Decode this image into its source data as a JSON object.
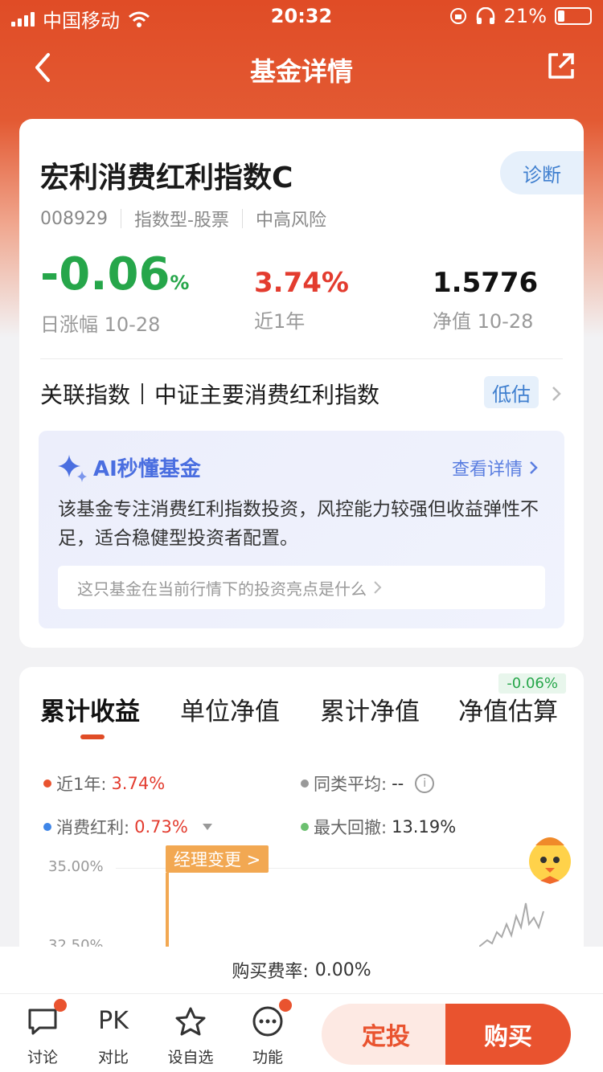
{
  "status_bar": {
    "carrier": "中国移动",
    "time": "20:32",
    "battery": "21%"
  },
  "nav": {
    "title": "基金详情"
  },
  "fund": {
    "name": "宏利消费红利指数C",
    "diagnose_label": "诊断",
    "code": "008929",
    "type": "指数型-股票",
    "risk": "中高风险",
    "daily_change": "-0.06",
    "daily_change_unit": "%",
    "daily_change_label": "日涨幅 10-28",
    "year_return": "3.74%",
    "year_return_label": "近1年",
    "nav_value": "1.5776",
    "nav_label": "净值 10-28",
    "index_prefix": "关联指数",
    "index_name": "中证主要消费红利指数",
    "valuation": "低估"
  },
  "ai": {
    "title": "AI秒懂基金",
    "more": "查看详情",
    "summary": "该基金专注消费红利指数投资，风控能力较强但收益弹性不足，适合稳健型投资者配置。",
    "question": "这只基金在当前行情下的投资亮点是什么"
  },
  "performance": {
    "tabs": [
      "累计收益",
      "单位净值",
      "累计净值",
      "净值估算"
    ],
    "estimate_badge": "-0.06%",
    "legend": {
      "year_label": "近1年:",
      "year_value": "3.74%",
      "peer_label": "同类平均:",
      "peer_value": "--",
      "index_label": "消费红利:",
      "index_value": "0.73%",
      "drawdown_label": "最大回撤:",
      "drawdown_value": "13.19%"
    },
    "colors": {
      "fund": "#e9532f",
      "peer": "#999999",
      "index": "#3f86e8",
      "drawdown": "#6cc070"
    },
    "y_ticks": [
      "35.00%",
      "32.50%"
    ],
    "manager_tag": "经理变更 >"
  },
  "fee": {
    "label": "购买费率:",
    "value": "0.00%"
  },
  "bottom": {
    "discuss": "讨论",
    "compare_icon": "PK",
    "compare": "对比",
    "watchlist": "设自选",
    "functions": "功能",
    "auto_invest": "定投",
    "buy": "购买"
  }
}
